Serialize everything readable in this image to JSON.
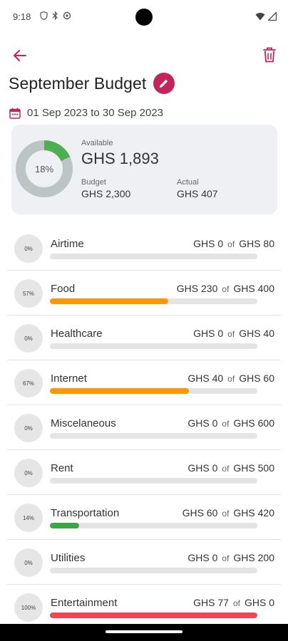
{
  "status_bar": {
    "time": "9:18",
    "icons": [
      "shield-icon",
      "bluetooth-icon",
      "sync-icon",
      "wifi-icon",
      "signal-icon"
    ]
  },
  "app_bar": {
    "back_icon": "arrow-left-icon",
    "delete_icon": "trash-icon"
  },
  "header": {
    "title": "September Budget",
    "edit_icon": "pencil-icon",
    "date_icon": "calendar-icon",
    "date_range": "01 Sep 2023 to 30 Sep 2023"
  },
  "summary": {
    "percent_used": 18,
    "percent_text": "18%",
    "available_label": "Available",
    "available_value": "GHS 1,893",
    "budget_label": "Budget",
    "budget_value": "GHS 2,300",
    "actual_label": "Actual",
    "actual_value": "GHS 407"
  },
  "colors": {
    "accent": "#c3245a",
    "donut_used": "#4caf50",
    "donut_remaining": "#bcc5c4",
    "bar_orange": "#ff9800",
    "bar_green": "#3aa845",
    "bar_red": "#f44352",
    "card_bg": "#eff0f3"
  },
  "categories": [
    {
      "name": "Airtime",
      "pct_text": "0%",
      "actual": "GHS 0",
      "of": "of",
      "budget": "GHS 80",
      "fill": 0,
      "color": "#ff9800"
    },
    {
      "name": "Food",
      "pct_text": "57%",
      "actual": "GHS 230",
      "of": "of",
      "budget": "GHS 400",
      "fill": 0.57,
      "color": "#ff9800"
    },
    {
      "name": "Healthcare",
      "pct_text": "0%",
      "actual": "GHS 0",
      "of": "of",
      "budget": "GHS 40",
      "fill": 0,
      "color": "#ff9800"
    },
    {
      "name": "Internet",
      "pct_text": "67%",
      "actual": "GHS 40",
      "of": "of",
      "budget": "GHS 60",
      "fill": 0.67,
      "color": "#ff9800"
    },
    {
      "name": "Miscelaneous",
      "pct_text": "0%",
      "actual": "GHS 0",
      "of": "of",
      "budget": "GHS 600",
      "fill": 0,
      "color": "#ff9800"
    },
    {
      "name": "Rent",
      "pct_text": "0%",
      "actual": "GHS 0",
      "of": "of",
      "budget": "GHS 500",
      "fill": 0,
      "color": "#ff9800"
    },
    {
      "name": "Transportation",
      "pct_text": "14%",
      "actual": "GHS 60",
      "of": "of",
      "budget": "GHS 420",
      "fill": 0.14,
      "color": "#3aa845"
    },
    {
      "name": "Utilities",
      "pct_text": "0%",
      "actual": "GHS 0",
      "of": "of",
      "budget": "GHS 200",
      "fill": 0,
      "color": "#ff9800"
    },
    {
      "name": "Entertainment",
      "pct_text": "100%",
      "actual": "GHS 77",
      "of": "of",
      "budget": "GHS 0",
      "fill": 1,
      "color": "#f44352"
    }
  ]
}
